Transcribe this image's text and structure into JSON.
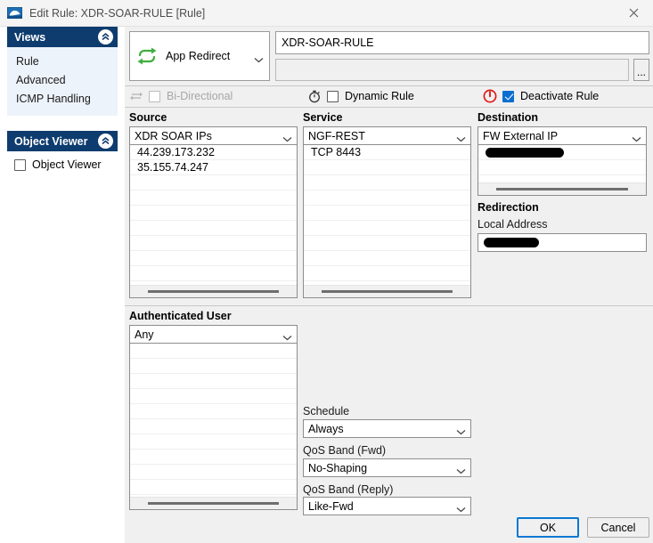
{
  "window": {
    "title": "Edit Rule: XDR-SOAR-RULE [Rule]",
    "app_icon": "rule-icon",
    "close_icon": "close-icon"
  },
  "sidebar": {
    "views_panel": {
      "header": "Views",
      "collapse_icon": "chevron-double-up-icon",
      "items": [
        {
          "label": "Rule"
        },
        {
          "label": "Advanced"
        },
        {
          "label": "ICMP Handling"
        }
      ]
    },
    "object_viewer_panel": {
      "header": "Object Viewer",
      "collapse_icon": "chevron-double-up-icon",
      "checkbox_label": "Object Viewer",
      "checked": false
    }
  },
  "rule": {
    "action": {
      "label": "App Redirect",
      "icon": "redirect-arrows-icon",
      "dropdown_icon": "chevron-down-icon"
    },
    "name_value": "XDR-SOAR-RULE",
    "description_value": "",
    "browse_button_label": "...",
    "options": [
      {
        "label": "Bi-Directional",
        "icon": "bidirectional-arrows-icon",
        "checked": false,
        "disabled": true
      },
      {
        "label": "Dynamic Rule",
        "icon": "stopwatch-icon",
        "checked": false,
        "disabled": false
      },
      {
        "label": "Deactivate Rule",
        "icon": "power-off-icon",
        "checked": true,
        "disabled": false
      }
    ]
  },
  "source": {
    "header": "Source",
    "selected": "XDR SOAR IPs",
    "dropdown_icon": "chevron-down-icon",
    "entries": [
      "44.239.173.232",
      "35.155.74.247"
    ]
  },
  "service": {
    "header": "Service",
    "selected": "NGF-REST",
    "dropdown_icon": "chevron-down-icon",
    "entries": [
      "TCP  8443"
    ]
  },
  "destination": {
    "header": "Destination",
    "selected": "FW External IP",
    "dropdown_icon": "chevron-down-icon",
    "entries": [
      "[redacted]"
    ]
  },
  "redirection": {
    "header": "Redirection",
    "local_address_label": "Local Address",
    "local_address_value": "[redacted]"
  },
  "authenticated_user": {
    "header": "Authenticated User",
    "selected": "Any",
    "dropdown_icon": "chevron-down-icon",
    "entries": []
  },
  "settings": {
    "schedule": {
      "label": "Schedule",
      "value": "Always",
      "dropdown_icon": "chevron-down-icon"
    },
    "qos_fwd": {
      "label": "QoS Band (Fwd)",
      "value": "No-Shaping",
      "dropdown_icon": "chevron-down-icon"
    },
    "qos_reply": {
      "label": "QoS Band (Reply)",
      "value": "Like-Fwd",
      "dropdown_icon": "chevron-down-icon"
    }
  },
  "footer": {
    "ok_label": "OK",
    "cancel_label": "Cancel"
  },
  "colors": {
    "panel_header": "#0e3c6e",
    "panel_body": "#edf3fa",
    "accent_checked": "#0a6ed1",
    "power_red": "#e01b1b",
    "redirect_green": "#3fae3f",
    "focus_blue": "#0a78d4"
  }
}
